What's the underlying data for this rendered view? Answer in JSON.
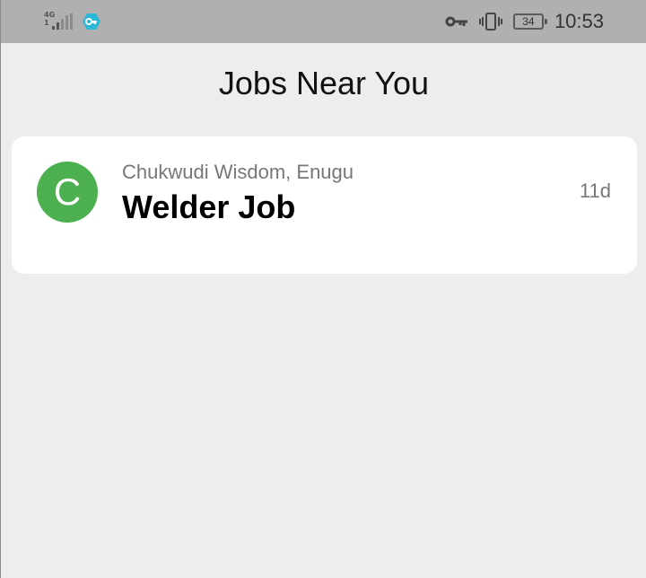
{
  "status_bar": {
    "network_type": "4G",
    "network_sub": "1",
    "battery_level": "34",
    "time": "10:53",
    "icons": [
      "signal-icon",
      "vpn-icon",
      "key-icon",
      "vibrate-icon",
      "battery-icon"
    ]
  },
  "header": {
    "title": "Jobs Near You"
  },
  "jobs": [
    {
      "avatar_letter": "C",
      "avatar_color": "#4caf50",
      "poster_location": "Chukwudi Wisdom, Enugu",
      "title": "Welder Job",
      "age": "11d"
    }
  ]
}
